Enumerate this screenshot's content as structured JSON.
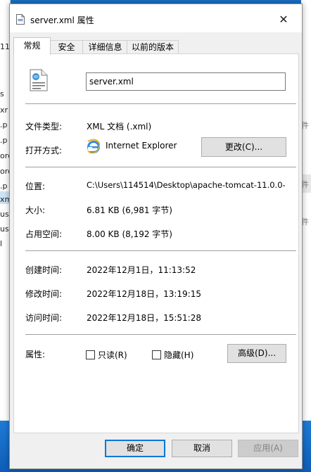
{
  "background": {
    "left_fragments": [
      "11",
      "s",
      "xr",
      ".p",
      ".p",
      "ore",
      "ore",
      ".p",
      "xm",
      "us",
      "us",
      "l"
    ],
    "right_fragments": [
      "件",
      "件",
      "件"
    ]
  },
  "dialog": {
    "title": "server.xml 属性",
    "close_label": "✕"
  },
  "tabs": [
    {
      "label": "常规",
      "active": true
    },
    {
      "label": "安全",
      "active": false
    },
    {
      "label": "详细信息",
      "active": false
    },
    {
      "label": "以前的版本",
      "active": false
    }
  ],
  "general": {
    "filename": "server.xml",
    "file_type_label": "文件类型:",
    "file_type_value": "XML 文档 (.xml)",
    "opens_with_label": "打开方式:",
    "opens_with_value": "Internet Explorer",
    "change_button": "更改(C)...",
    "location_label": "位置:",
    "location_value": "C:\\Users\\114514\\Desktop\\apache-tomcat-11.0.0-",
    "size_label": "大小:",
    "size_value": "6.81 KB (6,981 字节)",
    "size_on_disk_label": "占用空间:",
    "size_on_disk_value": "8.00 KB (8,192 字节)",
    "created_label": "创建时间:",
    "created_value": "2022年12月1日，11:13:52",
    "modified_label": "修改时间:",
    "modified_value": "2022年12月18日，13:19:15",
    "accessed_label": "访问时间:",
    "accessed_value": "2022年12月18日，15:51:28",
    "attributes_label": "属性:",
    "readonly_label": "只读(R)",
    "hidden_label": "隐藏(H)",
    "advanced_button": "高级(D)..."
  },
  "footer": {
    "ok": "确定",
    "cancel": "取消",
    "apply": "应用(A)"
  }
}
